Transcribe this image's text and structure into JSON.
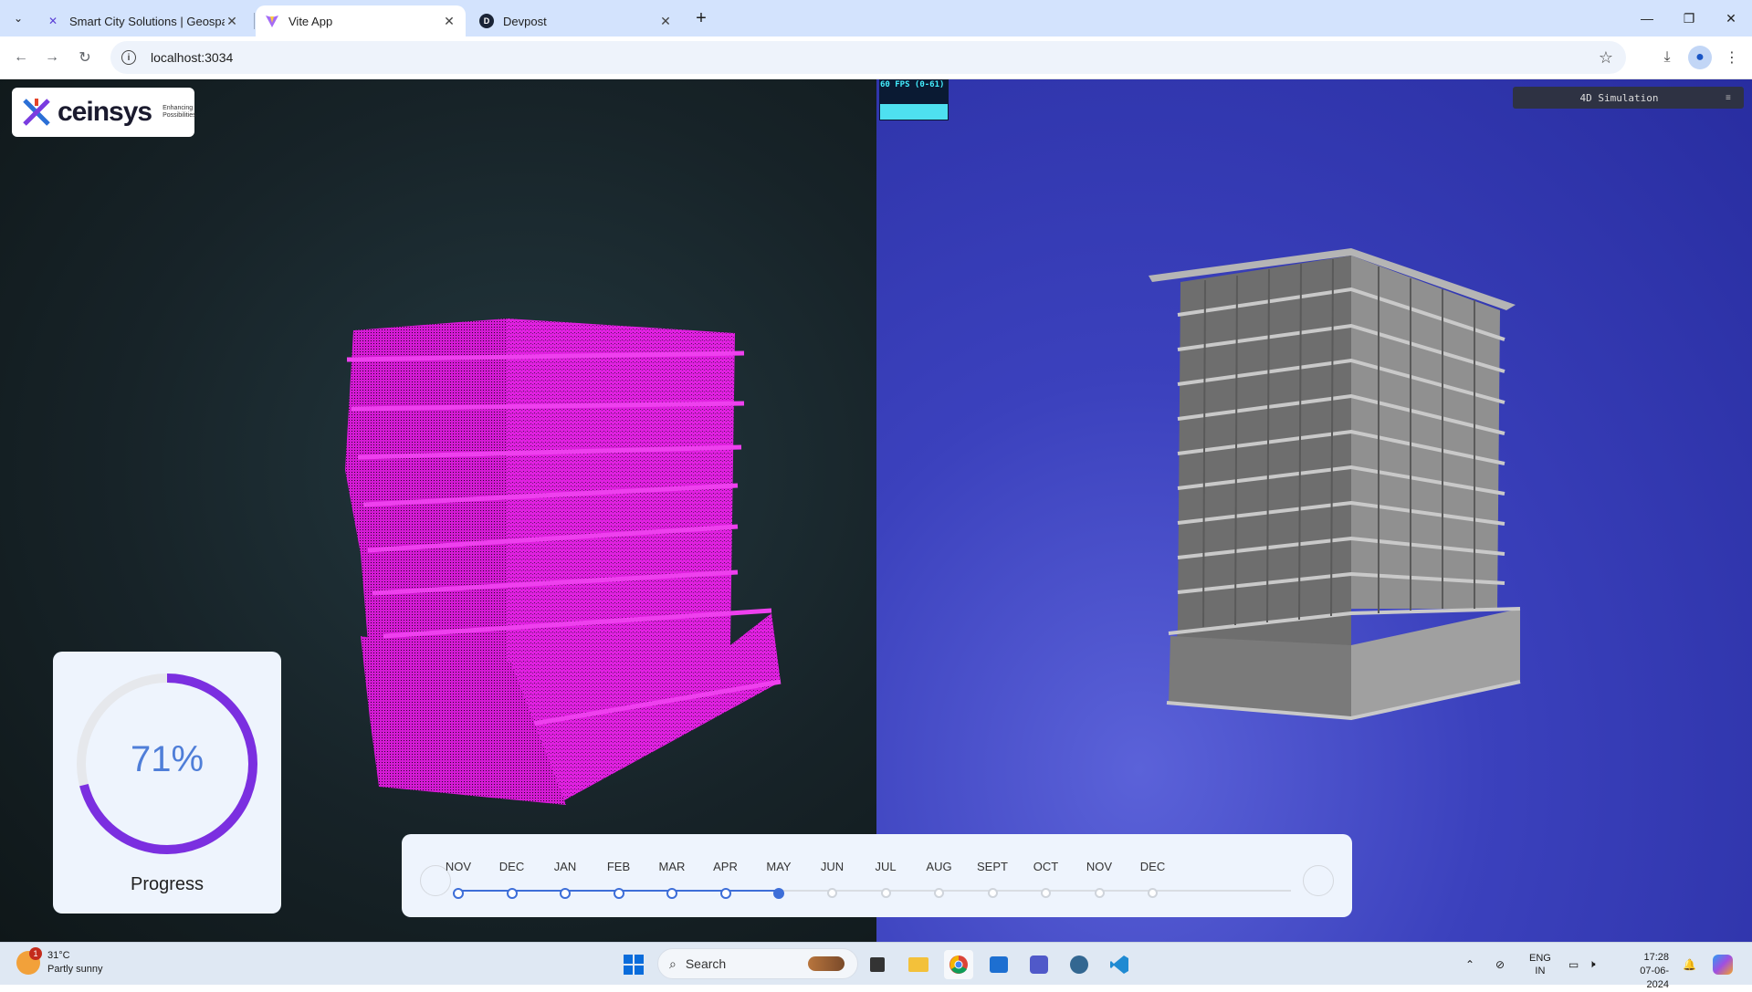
{
  "browser": {
    "tabs": [
      {
        "title": "Smart City Solutions | Geospati",
        "favicon": "ceinsys-icon",
        "active": false
      },
      {
        "title": "Vite App",
        "favicon": "vite-icon",
        "active": true
      },
      {
        "title": "Devpost",
        "favicon": "devpost-icon",
        "active": false
      }
    ],
    "url": "localhost:3034"
  },
  "app": {
    "logo": {
      "brand": "ceinsys",
      "tagline_1": "Enhancing",
      "tagline_2": "Possibilities"
    },
    "fps_label": "60 FPS (0-61)",
    "sim_panel_title": "4D Simulation",
    "progress": {
      "value": 0.71,
      "percent_text": "71%",
      "label": "Progress",
      "color": "#7b2fe0"
    },
    "timeline": {
      "months": [
        {
          "label": "NOV",
          "state": "done"
        },
        {
          "label": "DEC",
          "state": "done"
        },
        {
          "label": "JAN",
          "state": "done"
        },
        {
          "label": "FEB",
          "state": "done"
        },
        {
          "label": "MAR",
          "state": "done"
        },
        {
          "label": "APR",
          "state": "done"
        },
        {
          "label": "MAY",
          "state": "current"
        },
        {
          "label": "JUN",
          "state": "future"
        },
        {
          "label": "JUL",
          "state": "future"
        },
        {
          "label": "AUG",
          "state": "future"
        },
        {
          "label": "SEPT",
          "state": "future"
        },
        {
          "label": "OCT",
          "state": "future"
        },
        {
          "label": "NOV",
          "state": "future"
        },
        {
          "label": "DEC",
          "state": "future"
        }
      ],
      "accent": "#3d6ed8"
    },
    "left_model_color": "#e020e0",
    "right_model_color": "#8a8a8a"
  },
  "taskbar": {
    "weather_temp": "31°C",
    "weather_desc": "Partly sunny",
    "weather_badge": "1",
    "search_placeholder": "Search",
    "lang_1": "ENG",
    "lang_2": "IN",
    "time": "17:28",
    "date": "07-06-2024"
  }
}
